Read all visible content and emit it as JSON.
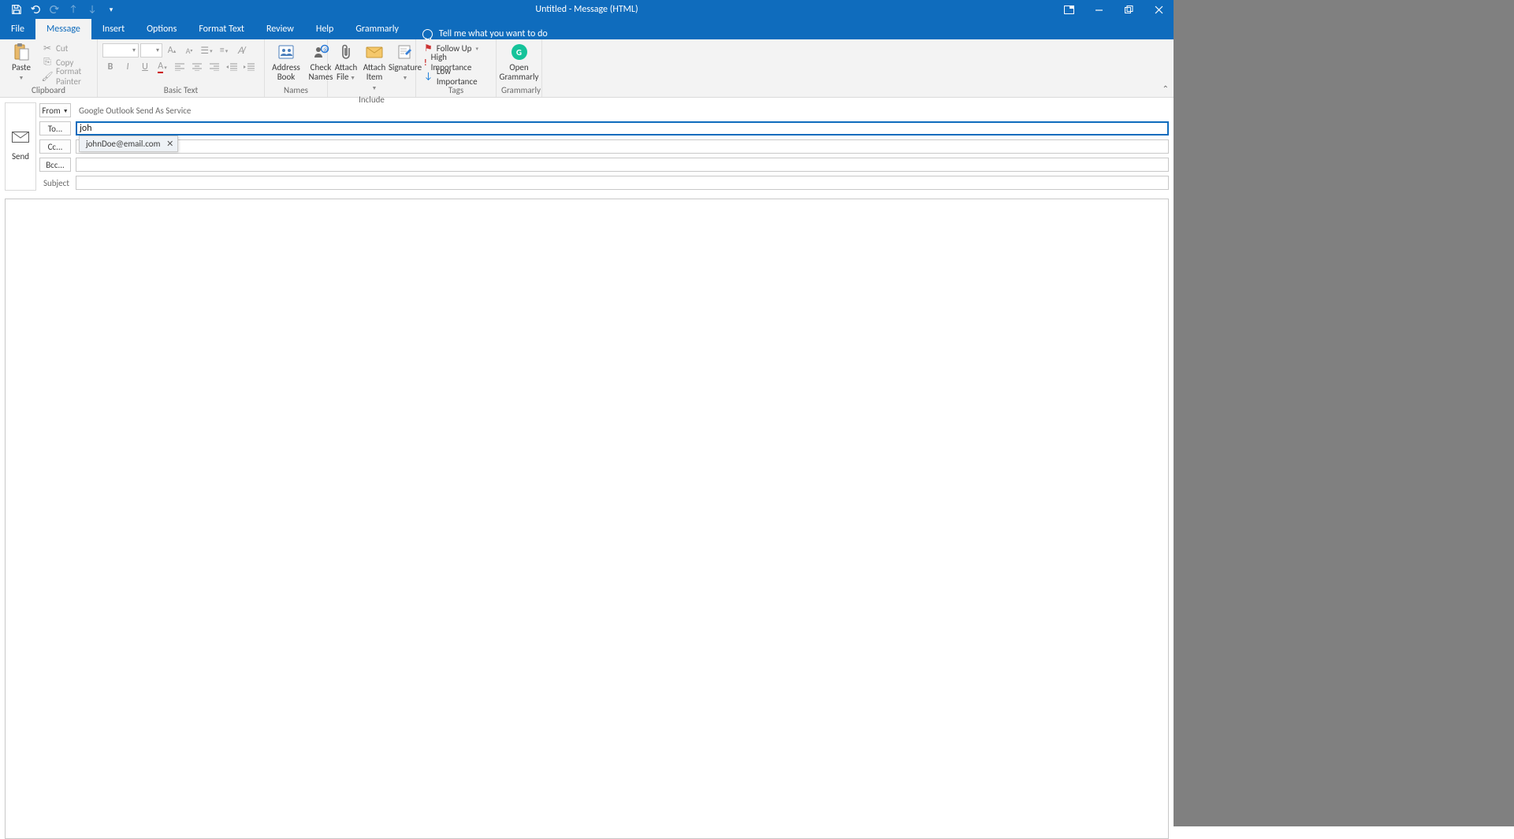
{
  "title": "Untitled - Message (HTML)",
  "tabs": {
    "file": "File",
    "message": "Message",
    "insert": "Insert",
    "options": "Options",
    "format_text": "Format Text",
    "review": "Review",
    "help": "Help",
    "grammarly": "Grammarly"
  },
  "tellme": "Tell me what you want to do",
  "ribbon": {
    "clipboard": {
      "label": "Clipboard",
      "paste": "Paste",
      "cut": "Cut",
      "copy": "Copy",
      "format_painter": "Format Painter"
    },
    "basic_text": {
      "label": "Basic Text"
    },
    "names": {
      "label": "Names",
      "address_book": "Address\nBook",
      "check_names": "Check\nNames"
    },
    "include": {
      "label": "Include",
      "attach_file": "Attach\nFile",
      "attach_item": "Attach\nItem",
      "signature": "Signature"
    },
    "tags": {
      "label": "Tags",
      "follow_up": "Follow Up",
      "high": "High Importance",
      "low": "Low Importance"
    },
    "grammarly": {
      "label": "Grammarly",
      "open": "Open\nGrammarly"
    }
  },
  "compose": {
    "send": "Send",
    "from_btn": "From",
    "from_value": "Google Outlook Send As Service",
    "to_btn": "To...",
    "to_value": "joh",
    "cc_btn": "Cc...",
    "bcc_btn": "Bcc...",
    "subject_label": "Subject",
    "suggestion": "johnDoe@email.com"
  }
}
